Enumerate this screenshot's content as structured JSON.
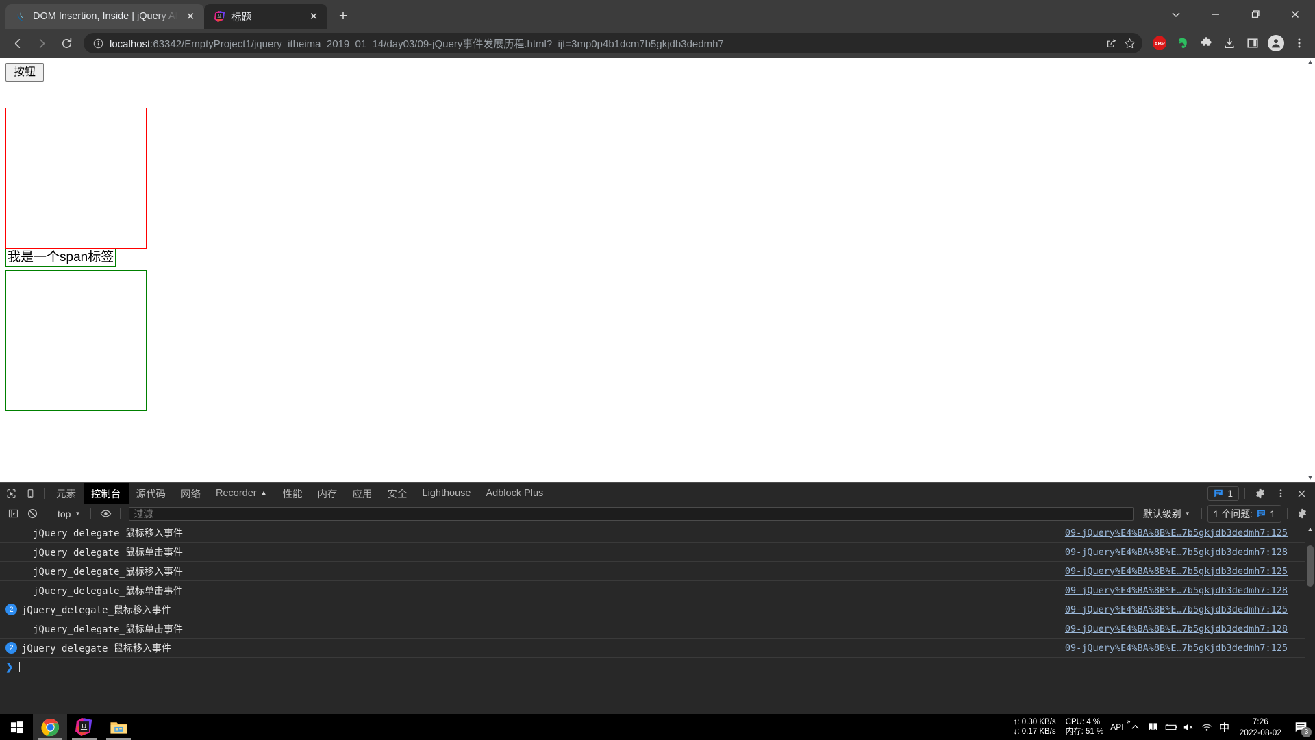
{
  "browser": {
    "tabs": [
      {
        "title": "DOM Insertion, Inside | jQuery API Documentation",
        "favicon": "jquery-icon",
        "active": false,
        "close_label": "✕"
      },
      {
        "title": "标题",
        "favicon": "intellij-icon",
        "active": true,
        "close_label": "✕"
      }
    ],
    "new_tab_label": "+",
    "window_controls": {
      "tab_search": "tab-search-chevron",
      "minimize": "minimize",
      "maximize": "maximize",
      "close": "close"
    },
    "nav": {
      "back": "back-arrow",
      "forward": "forward-arrow",
      "reload": "reload"
    },
    "omnibox": {
      "info_icon": "info-circle-icon",
      "url_host": "localhost",
      "url_rest": ":63342/EmptyProject1/jquery_itheima_2019_01_14/day03/09-jQuery事件发展历程.html?_ijt=3mp0p4b1dcm7b5gkjdb3dedmh7",
      "share_icon": "share-icon",
      "bookmark_icon": "star-icon"
    },
    "extensions": [
      {
        "name": "adblock-plus",
        "label": "ABP"
      },
      {
        "name": "evernote",
        "label": ""
      },
      {
        "name": "extensions-puzzle",
        "label": ""
      },
      {
        "name": "downloads",
        "label": ""
      },
      {
        "name": "side-panel",
        "label": ""
      }
    ],
    "profile_icon": "profile-avatar",
    "menu_icon": "three-dot-menu"
  },
  "page": {
    "button_label": "按钮",
    "span_label": "我是一个span标签",
    "red_box_color": "#ff0000",
    "green_box_color": "#008000"
  },
  "devtools": {
    "inspect_icon": "inspect-element-icon",
    "device_icon": "device-toolbar-icon",
    "tabs": [
      {
        "label": "元素",
        "active": false
      },
      {
        "label": "控制台",
        "active": true
      },
      {
        "label": "源代码",
        "active": false
      },
      {
        "label": "网络",
        "active": false
      },
      {
        "label": "Recorder",
        "active": false,
        "badge": "▲"
      },
      {
        "label": "性能",
        "active": false
      },
      {
        "label": "内存",
        "active": false
      },
      {
        "label": "应用",
        "active": false
      },
      {
        "label": "安全",
        "active": false
      },
      {
        "label": "Lighthouse",
        "active": false
      },
      {
        "label": "Adblock Plus",
        "active": false
      }
    ],
    "message_count": "1",
    "settings_icon": "gear-icon",
    "more_icon": "three-dot-menu-icon",
    "close_icon": "close-icon",
    "filterbar": {
      "sidebar_icon": "console-sidebar-icon",
      "clear_icon": "clear-console-icon",
      "context": "top",
      "eye_icon": "live-expression-icon",
      "filter_placeholder": "过滤",
      "level": "默认级别",
      "issues_label": "1 个问题:",
      "issues_count": "1",
      "settings_icon": "gear-icon"
    },
    "logs": [
      {
        "count": "",
        "text": "jQuery_delegate_鼠标移入事件",
        "source": "09-jQuery%E4%BA%8B%E…7b5gkjdb3dedmh7:125"
      },
      {
        "count": "",
        "text": "jQuery_delegate_鼠标单击事件",
        "source": "09-jQuery%E4%BA%8B%E…7b5gkjdb3dedmh7:128"
      },
      {
        "count": "",
        "text": "jQuery_delegate_鼠标移入事件",
        "source": "09-jQuery%E4%BA%8B%E…7b5gkjdb3dedmh7:125"
      },
      {
        "count": "",
        "text": "jQuery_delegate_鼠标单击事件",
        "source": "09-jQuery%E4%BA%8B%E…7b5gkjdb3dedmh7:128"
      },
      {
        "count": "2",
        "text": "jQuery_delegate_鼠标移入事件",
        "source": "09-jQuery%E4%BA%8B%E…7b5gkjdb3dedmh7:125"
      },
      {
        "count": "",
        "text": "jQuery_delegate_鼠标单击事件",
        "source": "09-jQuery%E4%BA%8B%E…7b5gkjdb3dedmh7:128"
      },
      {
        "count": "2",
        "text": "jQuery_delegate_鼠标移入事件",
        "source": "09-jQuery%E4%BA%8B%E…7b5gkjdb3dedmh7:125"
      }
    ],
    "prompt_symbol": "❯"
  },
  "taskbar": {
    "start_icon": "windows-start-icon",
    "apps": [
      {
        "name": "chrome",
        "active": true
      },
      {
        "name": "intellij-idea",
        "active": false
      },
      {
        "name": "file-explorer",
        "active": false
      }
    ],
    "tray": {
      "upload_speed": "↑: 0.30 KB/s",
      "download_speed": "↓: 0.17 KB/s",
      "cpu": "CPU: 4 %",
      "memory": "内存: 51 %",
      "api_label": "API",
      "overflow_icon": "show-hidden-icons-chevron",
      "icons": [
        "bookmark-icon",
        "battery-icon",
        "speaker-muted-icon",
        "wifi-icon"
      ],
      "ime_label": "中",
      "time": "7:26",
      "date": "2022-08-02",
      "notification_count": "3"
    }
  }
}
